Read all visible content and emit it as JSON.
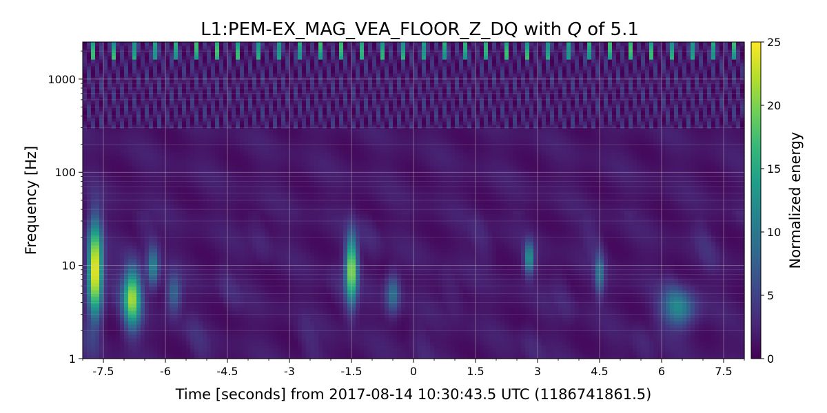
{
  "chart_data": {
    "type": "heatmap",
    "title_prefix": "L1:PEM-EX_MAG_VEA_FLOOR_Z_DQ with ",
    "title_symbol": "Q",
    "title_suffix": " of 5.1",
    "xlabel": "Time [seconds] from 2017-08-14 10:30:43.5 UTC (1186741861.5)",
    "ylabel": "Frequency [Hz]",
    "colorbar_label": "Normalized energy",
    "xlim": [
      -8,
      8
    ],
    "ylim": [
      1,
      2500
    ],
    "y_scale": "log",
    "grid": true,
    "x_ticks": [
      -7.5,
      -6,
      -4.5,
      -3,
      -1.5,
      0,
      1.5,
      3,
      4.5,
      6,
      7.5
    ],
    "x_tick_labels": [
      "-7.5",
      "-6",
      "-4.5",
      "-3",
      "-1.5",
      "0",
      "1.5",
      "3",
      "4.5",
      "6",
      "7.5"
    ],
    "y_ticks": [
      1,
      10,
      100,
      1000
    ],
    "y_tick_labels": [
      "1",
      "10",
      "100",
      "1000"
    ],
    "colorbar_range": [
      0,
      25
    ],
    "colorbar_ticks": [
      0,
      5,
      10,
      15,
      20,
      25
    ],
    "colorbar_tick_labels": [
      "0",
      "5",
      "10",
      "15",
      "20",
      "25"
    ],
    "colormap": [
      "#440154",
      "#482878",
      "#3e4989",
      "#31688e",
      "#26828e",
      "#1f9e89",
      "#35b779",
      "#6ece58",
      "#b5de2b",
      "#fde725"
    ],
    "background_energy": 1.5,
    "high_freq_band": {
      "fmin": 300,
      "fmax": 2500,
      "mean_energy": 5
    },
    "blobs": [
      {
        "t": -7.7,
        "f": 9,
        "energy": 25,
        "t_width": 0.12,
        "f_spread": 0.35
      },
      {
        "t": -6.8,
        "f": 4.5,
        "energy": 20,
        "t_width": 0.15,
        "f_spread": 0.22
      },
      {
        "t": -6.3,
        "f": 9.5,
        "energy": 10,
        "t_width": 0.1,
        "f_spread": 0.15
      },
      {
        "t": -1.5,
        "f": 9,
        "energy": 20,
        "t_width": 0.1,
        "f_spread": 0.25
      },
      {
        "t": 2.8,
        "f": 12,
        "energy": 12,
        "t_width": 0.08,
        "f_spread": 0.12
      },
      {
        "t": 6.4,
        "f": 3.5,
        "energy": 9,
        "t_width": 0.3,
        "f_spread": 0.15
      },
      {
        "t": 4.5,
        "f": 8,
        "energy": 8,
        "t_width": 0.08,
        "f_spread": 0.15
      },
      {
        "t": -5.8,
        "f": 5,
        "energy": 7,
        "t_width": 0.12,
        "f_spread": 0.15
      },
      {
        "t": -0.5,
        "f": 5,
        "energy": 8,
        "t_width": 0.12,
        "f_spread": 0.15
      }
    ]
  }
}
